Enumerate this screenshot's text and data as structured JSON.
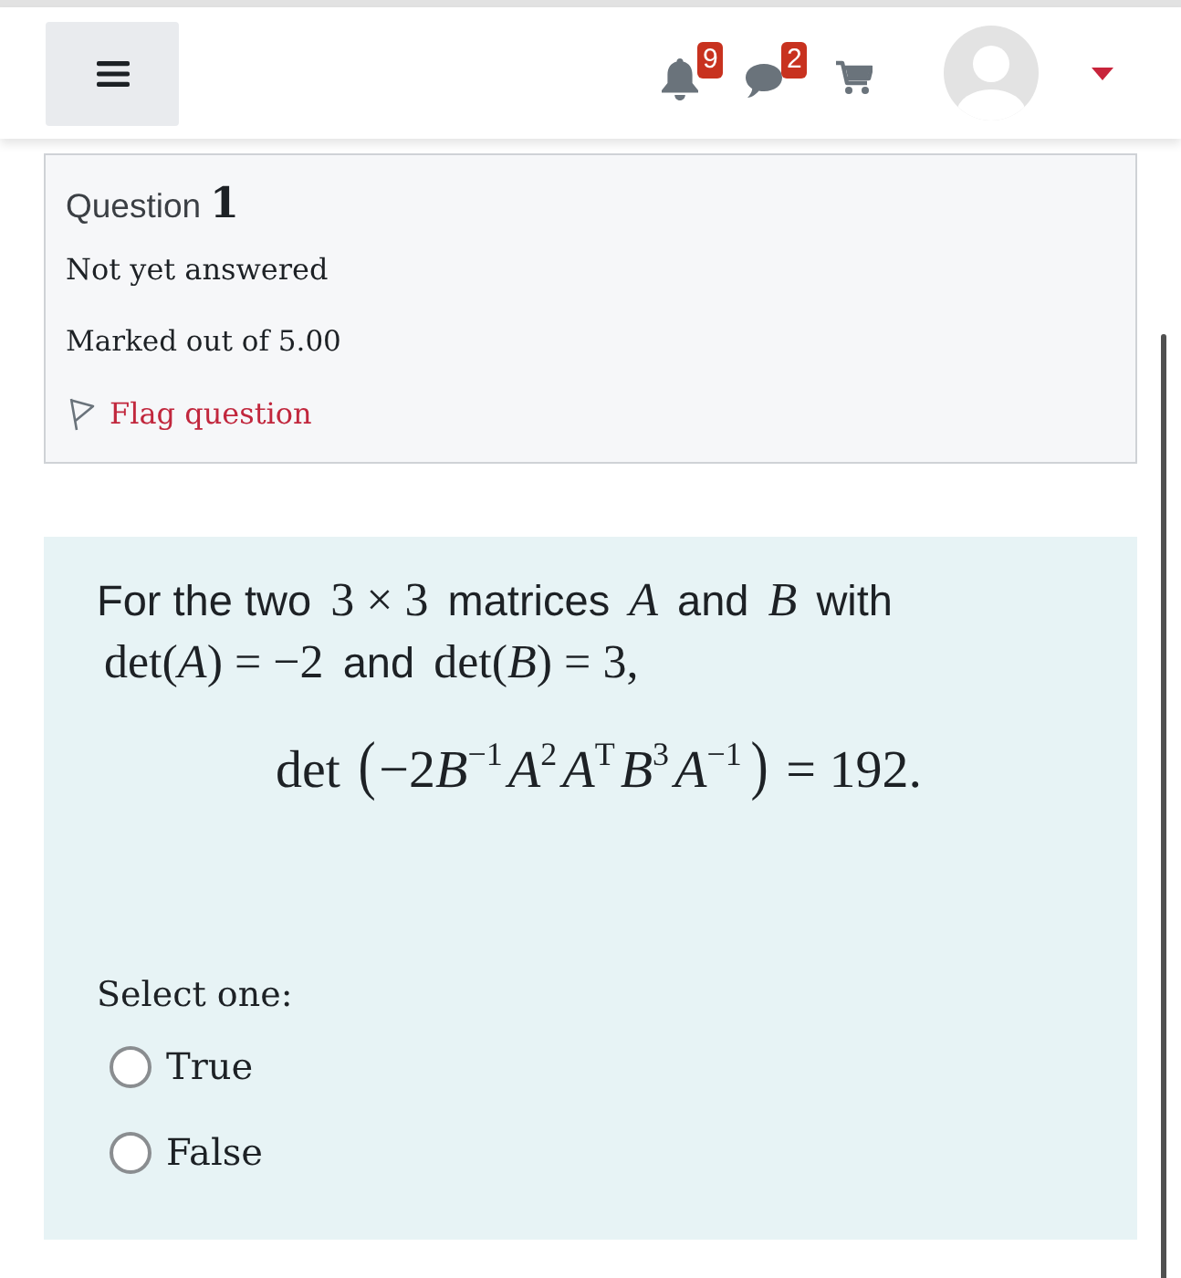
{
  "header": {
    "notifications": {
      "count": "9"
    },
    "messages": {
      "count": "2"
    }
  },
  "question_info": {
    "label": "Question",
    "number": "1",
    "state": "Not yet answered",
    "grade": "Marked out of 5.00",
    "flag_link": "Flag question"
  },
  "question": {
    "statement": [
      {
        "kind": "text",
        "text": "For the two"
      },
      {
        "kind": "math",
        "text": "3 × 3"
      },
      {
        "kind": "text",
        "text": "matrices"
      },
      {
        "kind": "math",
        "text": "*A*"
      },
      {
        "kind": "text",
        "text": "and"
      },
      {
        "kind": "math",
        "text": "*B*"
      },
      {
        "kind": "text",
        "text": "with"
      },
      {
        "kind": "math",
        "text": "det(*A*) = −2"
      },
      {
        "kind": "text",
        "text": "and"
      },
      {
        "kind": "math",
        "text": "det(*B*) = 3,"
      }
    ],
    "equation": {
      "lead": "det",
      "open": "(",
      "coefficient": "−2",
      "factors": [
        {
          "symbol": "B",
          "power": "−1"
        },
        {
          "symbol": "A",
          "power": "2"
        },
        {
          "symbol": "A",
          "power": "T"
        },
        {
          "symbol": "B",
          "power": "3"
        },
        {
          "symbol": "A",
          "power": "−1"
        }
      ],
      "close": ")",
      "result": "= 192."
    },
    "prompt": "Select one:",
    "options": [
      {
        "label": "True",
        "selected": false
      },
      {
        "label": "False",
        "selected": false
      }
    ]
  }
}
